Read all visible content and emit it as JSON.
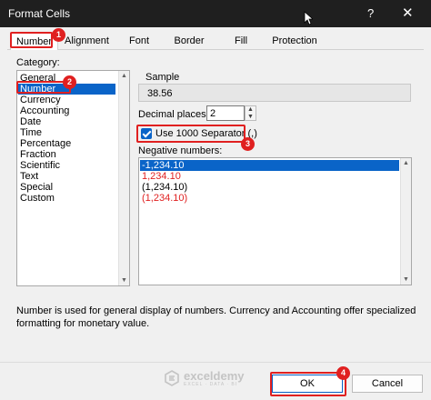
{
  "window": {
    "title": "Format Cells",
    "help": "?",
    "close": "✕"
  },
  "tabs": [
    "Number",
    "Alignment",
    "Font",
    "Border",
    "Fill",
    "Protection"
  ],
  "category": {
    "label": "Category:",
    "items": [
      "General",
      "Number",
      "Currency",
      "Accounting",
      "Date",
      "Time",
      "Percentage",
      "Fraction",
      "Scientific",
      "Text",
      "Special",
      "Custom"
    ],
    "selected": "Number"
  },
  "sample": {
    "label": "Sample",
    "value": "38.56"
  },
  "decimal_places": {
    "label": "Decimal places:",
    "value": "2"
  },
  "separator": {
    "label": "Use 1000 Separator (,)",
    "checked": true
  },
  "negative_numbers": {
    "label": "Negative numbers:",
    "items": [
      {
        "text": "-1,234.10",
        "color": "#000000",
        "selected": true
      },
      {
        "text": "1,234.10",
        "color": "#e02020",
        "selected": false
      },
      {
        "text": "(1,234.10)",
        "color": "#000000",
        "selected": false
      },
      {
        "text": "(1,234.10)",
        "color": "#e02020",
        "selected": false
      }
    ]
  },
  "description": "Number is used for general display of numbers.  Currency and Accounting offer specialized formatting for monetary value.",
  "buttons": {
    "ok": "OK",
    "cancel": "Cancel"
  },
  "badges": [
    "1",
    "2",
    "3",
    "4"
  ],
  "watermark": {
    "name": "exceldemy",
    "tag": "EXCEL · DATA · BI"
  },
  "colors": {
    "accent": "#0a64c8",
    "annotation": "#e02020",
    "titlebar": "#1f1f1f"
  }
}
